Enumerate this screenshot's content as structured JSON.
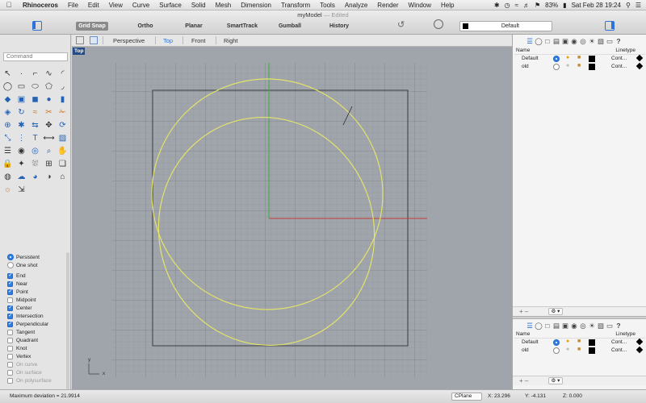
{
  "menubar": {
    "items": [
      "Rhinoceros",
      "File",
      "Edit",
      "View",
      "Curve",
      "Surface",
      "Solid",
      "Mesh",
      "Dimension",
      "Transform",
      "Tools",
      "Analyze",
      "Render",
      "Window",
      "Help"
    ],
    "battery": "83%",
    "datetime": "Sat Feb 28  19:24"
  },
  "window": {
    "title": "myModel",
    "edited": "— Edited"
  },
  "toolbar": {
    "buttons": [
      "Grid Snap",
      "Ortho",
      "Planar",
      "SmartTrack",
      "Gumball",
      "History"
    ],
    "layer_current": "Default"
  },
  "command": {
    "placeholder": "Command"
  },
  "icons": {
    "left_tools": [
      "arrow",
      "point",
      "polyline",
      "curve",
      "arc",
      "circle",
      "rectangle",
      "ellipse",
      "polygon",
      "fillet",
      "surface",
      "extrude",
      "box",
      "sphere",
      "cylinder",
      "loft",
      "revolve",
      "blend",
      "split",
      "trim",
      "join",
      "explode",
      "mirror",
      "move",
      "rotate",
      "scale",
      "array",
      "text",
      "dimension",
      "hatch",
      "layer",
      "render",
      "analyze",
      "zoom",
      "pan",
      "lock",
      "snap",
      "mesh",
      "grid",
      "group",
      "color",
      "environment",
      "globe",
      "material",
      "camera",
      "light",
      "transform"
    ]
  },
  "osnap": {
    "mode": [
      {
        "label": "Persistent",
        "on": true
      },
      {
        "label": "One shot",
        "on": false
      }
    ],
    "snaps": [
      {
        "label": "End",
        "on": true
      },
      {
        "label": "Near",
        "on": true
      },
      {
        "label": "Point",
        "on": true
      },
      {
        "label": "Midpoint",
        "on": false
      },
      {
        "label": "Center",
        "on": true
      },
      {
        "label": "Intersection",
        "on": true
      },
      {
        "label": "Perpendicular",
        "on": true
      },
      {
        "label": "Tangent",
        "on": false
      },
      {
        "label": "Quadrant",
        "on": false
      },
      {
        "label": "Knot",
        "on": false
      },
      {
        "label": "Vertex",
        "on": false
      }
    ],
    "disabled": [
      "On curve",
      "On surface",
      "On polysurface"
    ]
  },
  "views": {
    "tabs": [
      "Perspective",
      "Top",
      "Front",
      "Right"
    ],
    "active": "Top",
    "viewport_label": "Top"
  },
  "axis": {
    "y": "y",
    "x": "x"
  },
  "layers": {
    "header_name": "Name",
    "header_linetype": "Linetype",
    "rows": [
      {
        "name": "Default",
        "current": true,
        "visible": true,
        "linetype": "Cont..."
      },
      {
        "name": "old",
        "current": false,
        "visible": false,
        "linetype": "Cont..."
      }
    ]
  },
  "status": {
    "message": "Maximum deviation = 21.9914",
    "cplane": "CPlane",
    "x": "X: 23.296",
    "y": "Y: -4.131",
    "z": "Z: 0.000"
  },
  "colors": {
    "curve": "#e3e36a",
    "x_axis": "#c43c3c",
    "y_axis": "#3caa3c",
    "viewport_bg": "#a0a5ab",
    "accent": "#2c72d8"
  }
}
